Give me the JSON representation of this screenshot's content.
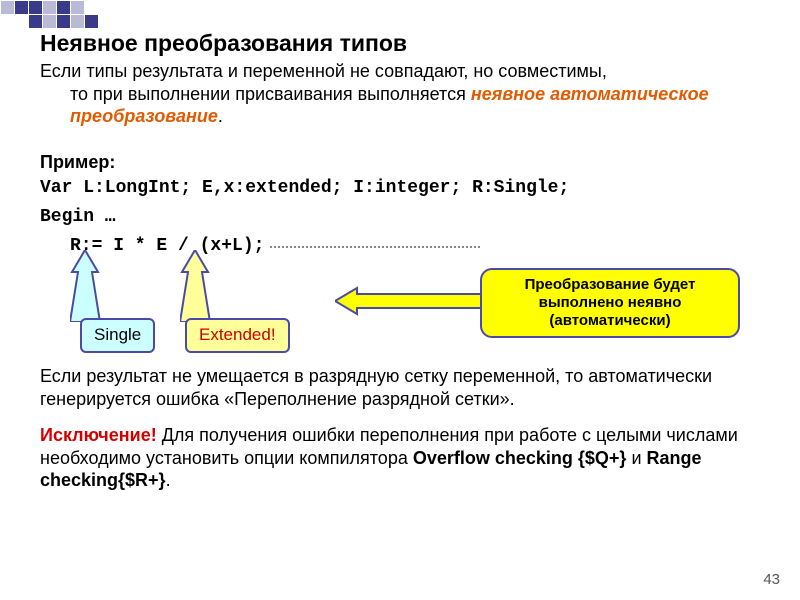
{
  "heading": "Неявное преобразования типов",
  "intro_line1": "Если типы результата и переменной не совпадают, но совместимы,",
  "intro_line2": "то при выполнении присваивания выполняется ",
  "intro_emph": "неявное автоматическое преобразование",
  "intro_period": ".",
  "example_label": "Пример:",
  "code_line1": "Var L:LongInt; E,x:extended; I:integer; R:Single;",
  "code_line2": "Begin …",
  "code_expr": "R:= I * E / (x+L);",
  "callout_single": "Single",
  "callout_extended": "Extended!",
  "note_line1": "Преобразование будет",
  "note_line2": "выполнено неявно",
  "note_line3": "(автоматически)",
  "para2": "Если результат не умещается в разрядную сетку переменной, то автоматически генерируется ошибка «Переполнение разрядной сетки».",
  "exc_label": "Исключение!",
  "exc_text1": " Для получения ошибки переполнения при работе с целыми числами необходимо установить опции компилятора ",
  "exc_opt1": "Overflow checking {$Q+}",
  "exc_and": " и ",
  "exc_opt2": "Range checking{$R+}",
  "exc_period": ".",
  "slide_num": "43"
}
